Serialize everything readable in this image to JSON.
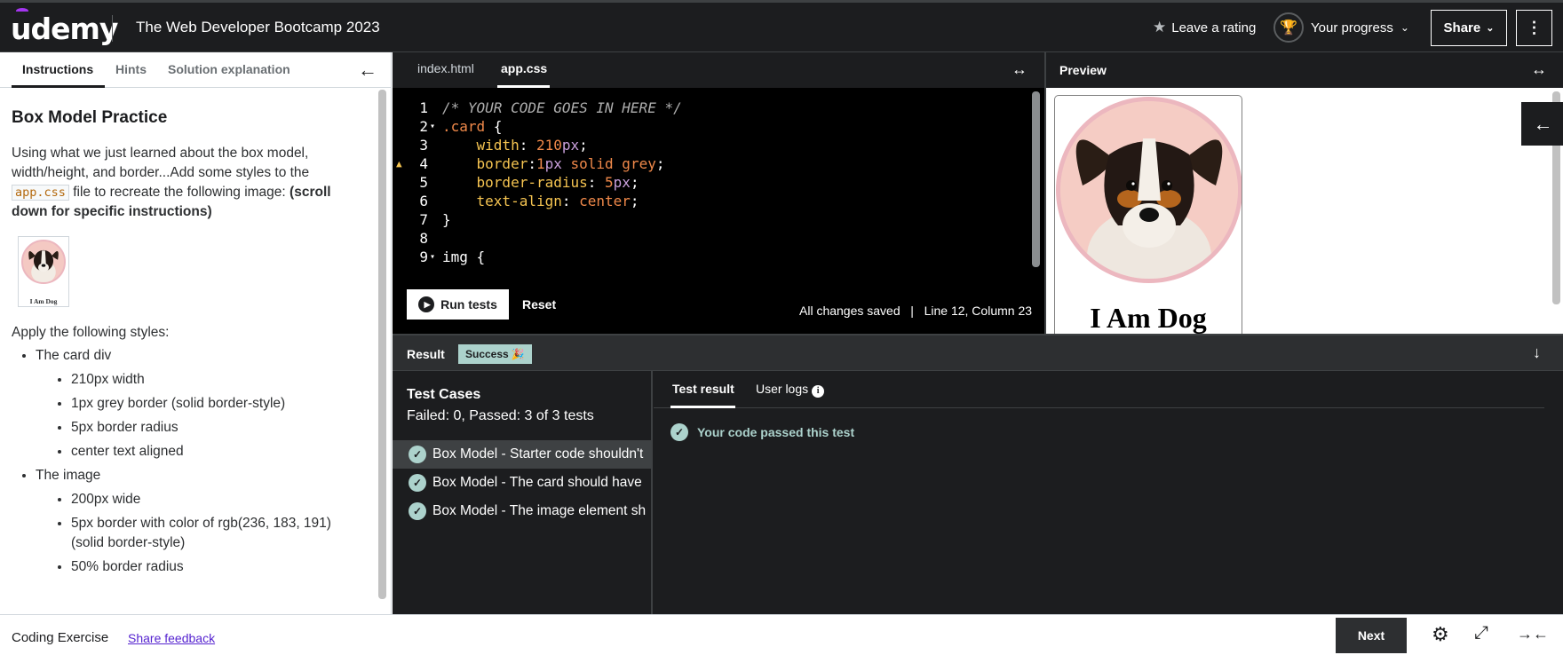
{
  "header": {
    "logo": "udemy",
    "course_title": "The Web Developer Bootcamp 2023",
    "rating_label": "Leave a rating",
    "progress_label": "Your progress",
    "share_label": "Share"
  },
  "instructions_panel": {
    "tabs": [
      "Instructions",
      "Hints",
      "Solution explanation"
    ],
    "heading": "Box Model Practice",
    "intro_before": "Using what we just learned about the box model, width/height, and border...Add some styles to the ",
    "intro_code": "app.css",
    "intro_after": " file to recreate the following image: ",
    "intro_bold": "(scroll down for specific instructions)",
    "thumb_caption": "I Am Dog",
    "apply_label": "Apply the following styles:",
    "groups": [
      {
        "title": "The card div",
        "items": [
          "210px width",
          "1px grey border (solid border-style)",
          "5px border radius",
          "center text aligned"
        ]
      },
      {
        "title": "The image",
        "items": [
          "200px wide",
          "5px border with color of rgb(236, 183, 191) (solid border-style)",
          "50% border radius"
        ]
      }
    ]
  },
  "editor": {
    "tabs": [
      "index.html",
      "app.css"
    ],
    "active_tab": "app.css",
    "lines": [
      {
        "n": "1",
        "fold": "",
        "warn": false
      },
      {
        "n": "2",
        "fold": "▾",
        "warn": false
      },
      {
        "n": "3",
        "fold": "",
        "warn": false
      },
      {
        "n": "4",
        "fold": "",
        "warn": true
      },
      {
        "n": "5",
        "fold": "",
        "warn": false
      },
      {
        "n": "6",
        "fold": "",
        "warn": false
      },
      {
        "n": "7",
        "fold": "",
        "warn": false
      },
      {
        "n": "8",
        "fold": "",
        "warn": false
      },
      {
        "n": "9",
        "fold": "▾",
        "warn": false
      }
    ],
    "code": {
      "l1": "/* YOUR CODE GOES IN HERE */",
      "l2_sel": ".card",
      "l2_brace": " {",
      "l3_prop": "    width",
      "l3_num": "210",
      "l3_unit": "px",
      "l4_prop": "    border",
      "l4_num": "1",
      "l4_unit": "px",
      "l4_rest": " solid grey",
      "l5_prop": "    border-radius",
      "l5_num": "5",
      "l5_unit": "px",
      "l6_prop": "    text-align",
      "l6_val": "center",
      "l7": "}",
      "l9_sel": "img",
      "l9_brace": " {",
      "colon": ": ",
      "colon_tight": ":",
      "semi": ";"
    },
    "run_label": "Run tests",
    "reset_label": "Reset",
    "status": "All changes saved   |   Line 12, Column 23"
  },
  "preview": {
    "title": "Preview",
    "card_title": "I Am Dog"
  },
  "result": {
    "label": "Result",
    "badge": "Success",
    "badge_emoji": "🎉"
  },
  "test_cases": {
    "title": "Test Cases",
    "summary": "Failed: 0, Passed: 3 of 3 tests",
    "items": [
      "Box Model - Starter code shouldn't",
      "Box Model - The card should have",
      "Box Model - The image element sh"
    ]
  },
  "test_result": {
    "tabs": [
      "Test result",
      "User logs"
    ],
    "message": "Your code passed this test"
  },
  "footer": {
    "type_label": "Coding Exercise",
    "feedback_label": "Share feedback",
    "next_label": "Next"
  },
  "colors": {
    "accent": "#a435f0",
    "success": "#acd2cc",
    "dog_border": "#ecb7bf",
    "link": "#5624d0"
  }
}
